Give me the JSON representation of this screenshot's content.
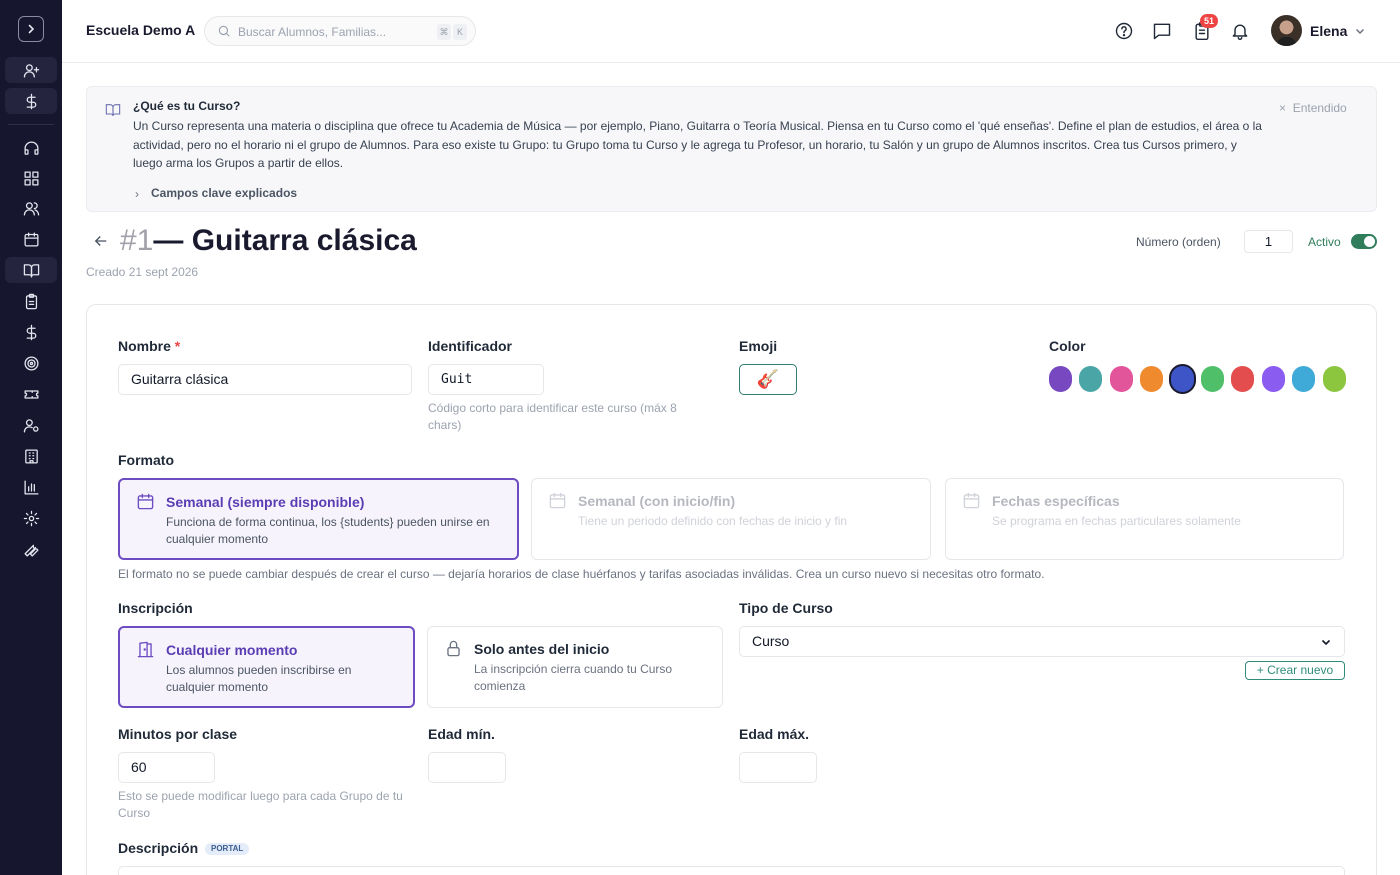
{
  "header": {
    "school_name": "Escuela Demo A",
    "search_placeholder": "Buscar Alumnos, Familias...",
    "shortcut_keys": [
      "⌘",
      "K"
    ],
    "notification_count": "51",
    "user_name": "Elena"
  },
  "sidebar": {
    "items": [
      "add-user",
      "billing",
      "support",
      "dashboard",
      "students",
      "calendar",
      "courses",
      "attendance",
      "payments",
      "goals",
      "tickets",
      "staff",
      "school",
      "reports",
      "settings",
      "tools"
    ],
    "active": "courses"
  },
  "info": {
    "title": "¿Qué es tu Curso?",
    "body": "Un Curso representa una materia o disciplina que ofrece tu Academia de Música — por ejemplo, Piano, Guitarra o Teoría Musical. Piensa en tu Curso como el 'qué enseñas'. Define el plan de estudios, el área o la actividad, pero no el horario ni el grupo de Alumnos. Para eso existe tu Grupo: tu Grupo toma tu Curso y le agrega tu Profesor, un horario, tu Salón y un grupo de Alumnos inscritos. Crea tus Cursos primero, y luego arma los Grupos a partir de ellos.",
    "expand_label": "Campos clave explicados",
    "dismiss_label": "Entendido"
  },
  "page": {
    "number": "#1",
    "title": "— Guitarra clásica",
    "created": "Creado 21 sept 2026",
    "order_label": "Número (orden)",
    "order_value": "1",
    "active_label": "Activo",
    "active": true
  },
  "form": {
    "name_label": "Nombre",
    "name_required": "*",
    "name_value": "Guitarra clásica",
    "identifier_label": "Identificador",
    "identifier_value": "Guit",
    "identifier_hint": "Código corto para identificar este curso (máx 8 chars)",
    "emoji_label": "Emoji",
    "emoji_value": "🎸",
    "color_label": "Color",
    "colors": [
      "#7848c0",
      "#4aa6a6",
      "#e2559a",
      "#f08a2e",
      "#3d55c7",
      "#4fbf6a",
      "#e34d4d",
      "#8a5cf0",
      "#3fa9d8",
      "#8cc63f"
    ],
    "selected_color": "#3d55c7",
    "format_label": "Formato",
    "format_options": [
      {
        "title": "Semanal (siempre disponible)",
        "desc": "Funciona de forma continua, los {students} pueden unirse en cualquier momento"
      },
      {
        "title": "Semanal (con inicio/fin)",
        "desc": "Tiene un periodo definido con fechas de inicio y fin"
      },
      {
        "title": "Fechas específicas",
        "desc": "Se programa en fechas particulares solamente"
      }
    ],
    "format_selected": "Semanal (siempre disponible)",
    "format_note": "El formato no se puede cambiar después de crear el curso — dejaría horarios de clase huérfanos y tarifas asociadas inválidas. Crea un curso nuevo si necesitas otro formato.",
    "enrollment_label": "Inscripción",
    "enrollment_options": [
      {
        "title": "Cualquier momento",
        "desc": "Los alumnos pueden inscribirse en cualquier momento"
      },
      {
        "title": "Solo antes del inicio",
        "desc": "La inscripción cierra cuando tu Curso comienza"
      }
    ],
    "enrollment_selected": "Cualquier momento",
    "course_type_label": "Tipo de Curso",
    "course_type_value": "Curso",
    "create_new_label": "+ Crear nuevo",
    "minutes_label": "Minutos por clase",
    "minutes_value": "60",
    "minutes_hint": "Esto se puede modificar luego para cada Grupo de tu Curso",
    "min_age_label": "Edad mín.",
    "min_age_value": "",
    "max_age_label": "Edad máx.",
    "max_age_value": "",
    "description_label": "Descripción",
    "description_badge": "PORTAL"
  }
}
